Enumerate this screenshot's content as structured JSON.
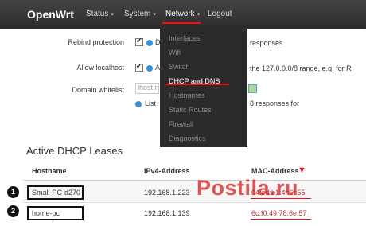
{
  "nav": {
    "brand": "OpenWrt",
    "items": [
      {
        "label": "Status",
        "caret": "▾"
      },
      {
        "label": "System",
        "caret": "▾"
      },
      {
        "label": "Network",
        "caret": "▾"
      },
      {
        "label": "Logout",
        "caret": ""
      }
    ]
  },
  "dnsmasq": {
    "rebind_label": "Rebind protection",
    "rebind_desc_prefix": "D",
    "rebind_desc_suffix": "responses",
    "localhost_label": "Allow localhost",
    "localhost_desc_prefix": "A",
    "localhost_desc_suffix": "the 127.0.0.0/8 range, e.g. for R",
    "whitelist_label": "Domain whitelist",
    "whitelist_value": "ihost.n",
    "whitelist_desc_prefix": "List",
    "whitelist_desc_suffix": "8 responses for"
  },
  "dropdown": {
    "items": [
      "Interfaces",
      "Wifi",
      "Switch",
      "DHCP and DNS",
      "Hostnames",
      "Static Routes",
      "Firewall",
      "Diagnostics"
    ],
    "active": "DHCP and DNS"
  },
  "leases": {
    "title": "Active DHCP Leases",
    "columns": [
      "Hostname",
      "IPv4-Address",
      "MAC-Address"
    ],
    "rows": [
      {
        "marker": "1",
        "hostname": "Small-PC-d270",
        "ip": "192.168.1.223",
        "mac": "04:ed:b1:4f:6f:55"
      },
      {
        "marker": "2",
        "hostname": "home-pc",
        "ip": "192.168.1.139",
        "mac": "6c:f0:49:78:6e:57"
      }
    ]
  },
  "watermark": "Postila.ru",
  "colors": {
    "accent": "#e11111",
    "navbar": "#2b2b2b",
    "info": "#3d8fd6"
  }
}
